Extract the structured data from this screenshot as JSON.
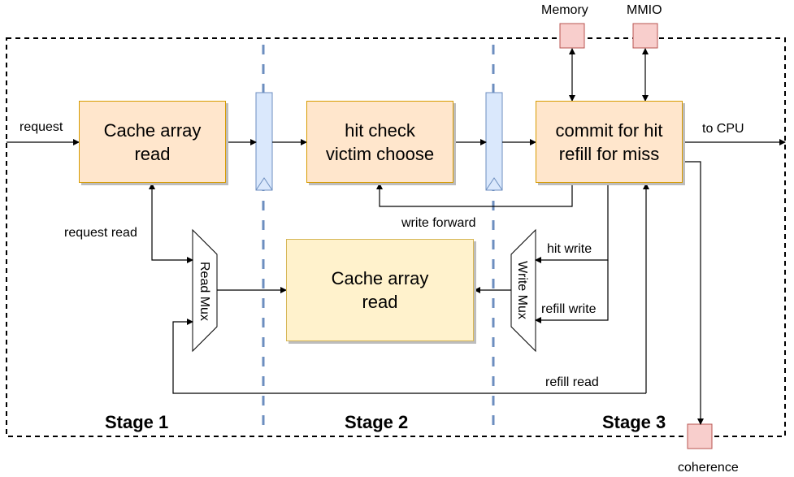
{
  "blocks": {
    "stage1_array_read": "Cache array\nread",
    "stage1_line1": "Cache array",
    "stage1_line2": "read",
    "stage2_line1": "hit check",
    "stage2_line2": "victim choose",
    "stage3_line1": "commit for hit",
    "stage3_line2": "refill for miss",
    "array_line1": "Cache array",
    "array_line2": "read"
  },
  "muxes": {
    "read": "Read Mux",
    "write": "Write Mux"
  },
  "external": {
    "memory": "Memory",
    "mmio": "MMIO",
    "coherence": "coherence"
  },
  "signals": {
    "request": "request",
    "to_cpu": "to CPU",
    "request_read": "request read",
    "write_forward": "write forward",
    "hit_write": "hit write",
    "refill_write": "refill write",
    "refill_read": "refill read"
  },
  "stages": [
    "Stage 1",
    "Stage 2",
    "Stage 3"
  ],
  "colors": {
    "block_fill": "#ffe6cc",
    "block_border": "#d79b00",
    "array_fill": "#fff2cc",
    "array_border": "#d6b656",
    "register_fill": "#dae8fc",
    "register_border": "#6c8ebf",
    "external_fill": "#f8cecc",
    "external_border": "#b85450",
    "stage_divider": "#6c8ebf"
  }
}
